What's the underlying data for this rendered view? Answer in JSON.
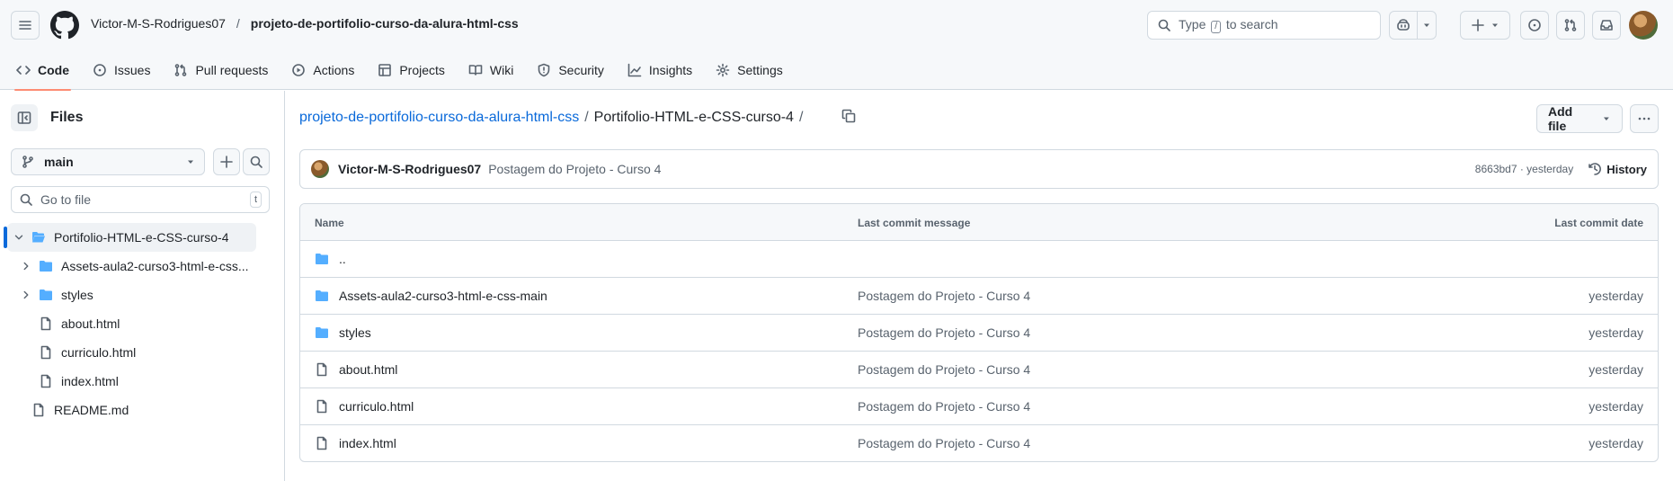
{
  "header": {
    "owner": "Victor-M-S-Rodrigues07",
    "separator": "/",
    "repo": "projeto-de-portifolio-curso-da-alura-html-css",
    "search_prefix": "Type",
    "search_key": "/",
    "search_suffix": "to search"
  },
  "repo_nav": {
    "tabs": [
      {
        "label": "Code",
        "icon": "code-icon",
        "active": true
      },
      {
        "label": "Issues",
        "icon": "issue-icon"
      },
      {
        "label": "Pull requests",
        "icon": "pull-request-icon"
      },
      {
        "label": "Actions",
        "icon": "play-icon"
      },
      {
        "label": "Projects",
        "icon": "table-icon"
      },
      {
        "label": "Wiki",
        "icon": "book-icon"
      },
      {
        "label": "Security",
        "icon": "shield-icon"
      },
      {
        "label": "Insights",
        "icon": "graph-icon"
      },
      {
        "label": "Settings",
        "icon": "gear-icon"
      }
    ]
  },
  "sidebar": {
    "title": "Files",
    "branch": "main",
    "goto_placeholder": "Go to file",
    "goto_shortcut": "t",
    "tree": [
      {
        "label": "Portifolio-HTML-e-CSS-curso-4",
        "type": "folder-open",
        "selected": true
      },
      {
        "label": "Assets-aula2-curso3-html-e-css...",
        "type": "folder"
      },
      {
        "label": "styles",
        "type": "folder"
      },
      {
        "label": "about.html",
        "type": "file"
      },
      {
        "label": "curriculo.html",
        "type": "file"
      },
      {
        "label": "index.html",
        "type": "file"
      },
      {
        "label": "README.md",
        "type": "file"
      }
    ]
  },
  "main": {
    "breadcrumb_repo": "projeto-de-portifolio-curso-da-alura-html-css",
    "breadcrumb_sep": "/",
    "breadcrumb_current": "Portifolio-HTML-e-CSS-curso-4",
    "add_file_label": "Add file",
    "commit": {
      "author": "Victor-M-S-Rodrigues07",
      "message": "Postagem do Projeto - Curso 4",
      "sha_time": "8663bd7 · yesterday",
      "history_label": "History"
    },
    "table": {
      "col_name": "Name",
      "col_message": "Last commit message",
      "col_date": "Last commit date",
      "rows": [
        {
          "name": "..",
          "type": "folder",
          "message": "",
          "date": ""
        },
        {
          "name": "Assets-aula2-curso3-html-e-css-main",
          "type": "folder",
          "message": "Postagem do Projeto - Curso 4",
          "date": "yesterday"
        },
        {
          "name": "styles",
          "type": "folder",
          "message": "Postagem do Projeto - Curso 4",
          "date": "yesterday"
        },
        {
          "name": "about.html",
          "type": "file",
          "message": "Postagem do Projeto - Curso 4",
          "date": "yesterday"
        },
        {
          "name": "curriculo.html",
          "type": "file",
          "message": "Postagem do Projeto - Curso 4",
          "date": "yesterday"
        },
        {
          "name": "index.html",
          "type": "file",
          "message": "Postagem do Projeto - Curso 4",
          "date": "yesterday"
        }
      ]
    }
  },
  "colors": {
    "link": "#0969da",
    "folder": "#54aeff",
    "active_tab_underline": "#fd8c73",
    "border": "#d1d9e0"
  }
}
